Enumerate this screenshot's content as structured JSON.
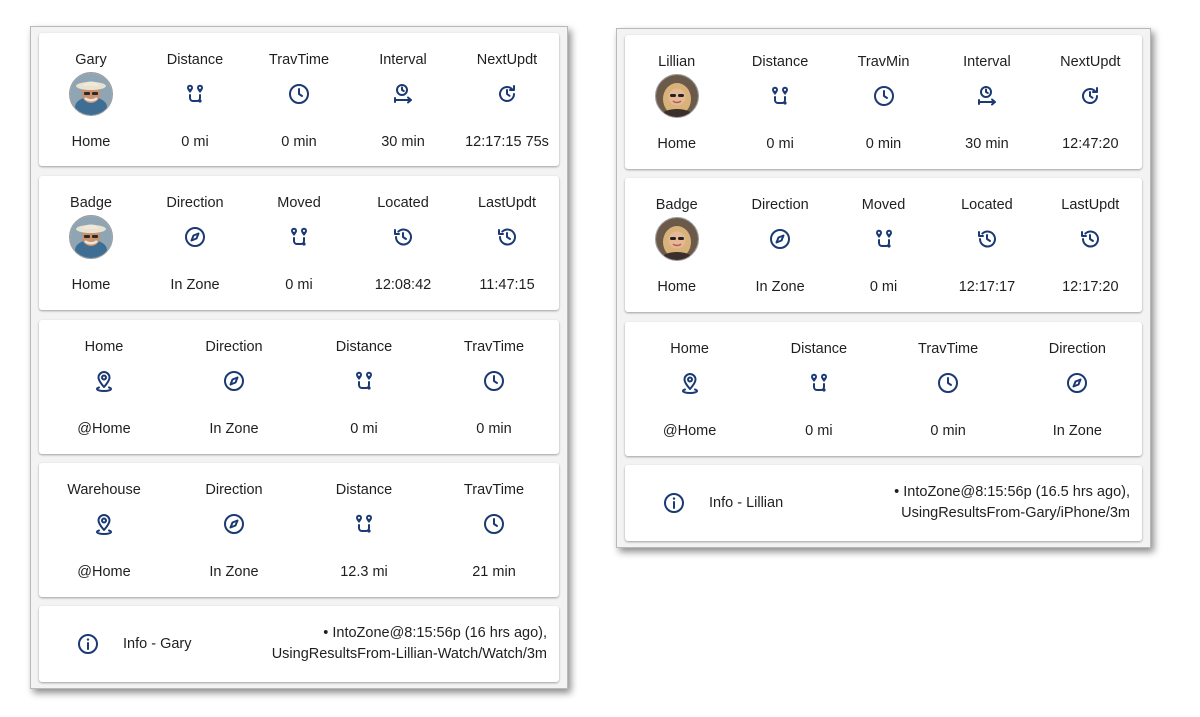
{
  "colors": {
    "icon": "#1b3a73",
    "text": "#1f1f1f",
    "panel_bg": "#f3f3f3",
    "card_bg": "#ffffff"
  },
  "gary": {
    "row1": {
      "headers": [
        "Gary",
        "Distance",
        "TravTime",
        "Interval",
        "NextUpdt"
      ],
      "icons": [
        "avatar-gary",
        "distance-icon",
        "clock-icon",
        "interval-icon",
        "update-icon"
      ],
      "values": [
        "Home",
        "0 mi",
        "0 min",
        "30 min",
        "12:17:15 75s"
      ]
    },
    "row2": {
      "headers": [
        "Badge",
        "Direction",
        "Moved",
        "Located",
        "LastUpdt"
      ],
      "icons": [
        "avatar-gary",
        "compass-icon",
        "distance-icon",
        "history-icon",
        "history-icon"
      ],
      "values": [
        "Home",
        "In Zone",
        "0 mi",
        "12:08:42",
        "11:47:15"
      ]
    },
    "row3": {
      "headers": [
        "Home",
        "Direction",
        "Distance",
        "TravTime"
      ],
      "icons": [
        "map-marker-icon",
        "compass-icon",
        "distance-icon",
        "clock-icon"
      ],
      "values": [
        "@Home",
        "In Zone",
        "0 mi",
        "0 min"
      ]
    },
    "row4": {
      "headers": [
        "Warehouse",
        "Direction",
        "Distance",
        "TravTime"
      ],
      "icons": [
        "map-marker-icon",
        "compass-icon",
        "distance-icon",
        "clock-icon"
      ],
      "values": [
        "@Home",
        "In Zone",
        "12.3 mi",
        "21 min"
      ]
    },
    "info": {
      "label": "Info - Gary",
      "line1": "• IntoZone@8:15:56p (16 hrs ago),",
      "line2": "UsingResultsFrom-Lillian-Watch/Watch/3m"
    }
  },
  "lillian": {
    "row1": {
      "headers": [
        "Lillian",
        "Distance",
        "TravMin",
        "Interval",
        "NextUpdt"
      ],
      "icons": [
        "avatar-lillian",
        "distance-icon",
        "clock-icon",
        "interval-icon",
        "update-icon"
      ],
      "values": [
        "Home",
        "0 mi",
        "0 min",
        "30 min",
        "12:47:20"
      ]
    },
    "row2": {
      "headers": [
        "Badge",
        "Direction",
        "Moved",
        "Located",
        "LastUpdt"
      ],
      "icons": [
        "avatar-lillian",
        "compass-icon",
        "distance-icon",
        "history-icon",
        "history-icon"
      ],
      "values": [
        "Home",
        "In Zone",
        "0 mi",
        "12:17:17",
        "12:17:20"
      ]
    },
    "row3": {
      "headers": [
        "Home",
        "Distance",
        "TravTime",
        "Direction"
      ],
      "icons": [
        "map-marker-icon",
        "distance-icon",
        "clock-icon",
        "compass-icon"
      ],
      "values": [
        "@Home",
        "0 mi",
        "0 min",
        "In Zone"
      ]
    },
    "info": {
      "label": "Info - Lillian",
      "line1": "• IntoZone@8:15:56p (16.5 hrs ago),",
      "line2": "UsingResultsFrom-Gary/iPhone/3m"
    }
  }
}
